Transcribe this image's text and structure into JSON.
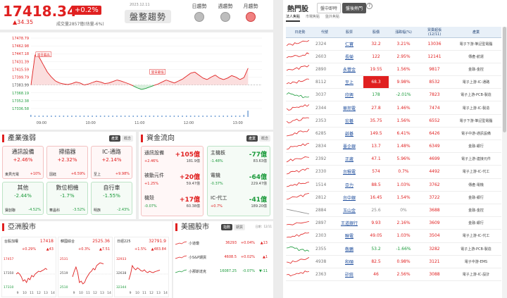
{
  "index": {
    "value": "17418.34",
    "change_pct": "+0.2%",
    "change_pts": "▲34.35",
    "volume": "成交量2857億(估量-6%)",
    "date": "2023.12.11",
    "trend": "盤整趨勢",
    "periods": [
      {
        "label": "日趨勢",
        "active": false
      },
      {
        "label": "週趨勢",
        "active": false
      },
      {
        "label": "月趨勢",
        "active": true
      }
    ]
  },
  "chart_data": {
    "type": "line",
    "y_ticks": [
      "17478.79",
      "17462.98",
      "17447.18",
      "17431.39",
      "17415.59",
      "17399.79",
      "17383.99",
      "17368.19",
      "17352.38",
      "17336.58"
    ],
    "x_ticks": [
      "09:00",
      "10:00",
      "11:00",
      "12:00",
      "13:00"
    ],
    "annotations": [
      "當日最高",
      "當日最低"
    ],
    "ylim": [
      17336.58,
      17478.79
    ],
    "series": [
      {
        "values": [
          17383.99,
          17445,
          17440,
          17425,
          17410,
          17400,
          17392,
          17388,
          17386,
          17385,
          17387,
          17390,
          17388,
          17384,
          17386,
          17389,
          17392,
          17390,
          17387,
          17388,
          17391,
          17394,
          17392,
          17389,
          17386,
          17382,
          17378,
          17375,
          17377,
          17380,
          17383,
          17386,
          17390,
          17394,
          17391,
          17388,
          17392,
          17396,
          17402,
          17408,
          17410,
          17404,
          17398,
          17395,
          17400,
          17404,
          17398,
          17395,
          17398,
          17403,
          17400,
          17395,
          17399,
          17418
        ]
      }
    ],
    "volume": [
      3,
      2,
      2,
      2,
      2,
      2,
      2,
      2,
      2,
      2,
      2,
      2,
      2,
      2,
      2,
      2,
      2,
      2,
      2,
      2,
      2,
      2,
      2,
      2,
      2,
      2,
      2,
      2,
      2,
      2,
      2,
      2,
      2,
      2,
      2,
      2,
      2,
      2,
      2,
      2,
      2,
      2,
      2,
      2,
      2,
      2,
      2,
      2,
      2,
      2,
      2,
      2,
      3,
      9
    ]
  },
  "industry": {
    "title": "產業強弱",
    "btns": [
      "產業",
      "概念"
    ],
    "cards": [
      {
        "name": "通訊設備",
        "pct": "+2.46%",
        "sub_name": "東貝光電",
        "sub_pct": "+10%",
        "up": true
      },
      {
        "name": "掃描器",
        "pct": "+2.32%",
        "sub_name": "因鈺",
        "sub_pct": "+6.59%",
        "up": true
      },
      {
        "name": "IC-通路",
        "pct": "+2.14%",
        "sub_name": "至上",
        "sub_pct": "+9.98%",
        "up": true
      },
      {
        "name": "其他",
        "pct": "-2.44%",
        "sub_name": "寶創聯",
        "sub_pct": "-4.52%",
        "up": false
      },
      {
        "name": "數位相機",
        "pct": "-1.7%",
        "sub_name": "華晶科",
        "sub_pct": "-3.52%",
        "up": false
      },
      {
        "name": "自行車",
        "pct": "-1.55%",
        "sub_name": "明族",
        "sub_pct": "-2.43%",
        "up": false
      }
    ]
  },
  "capital": {
    "title": "資金流向",
    "btns": [
      "產業",
      "概念"
    ],
    "items": [
      {
        "name": "通訊設備",
        "val": "+105億",
        "pct": "+2.46%",
        "vol": "181.9億",
        "up": true
      },
      {
        "name": "被動元件",
        "val": "+20億",
        "pct": "+1.25%",
        "vol": "59.47億",
        "up": true
      },
      {
        "name": "機殼",
        "val": "+17億",
        "pct": "-0.07%",
        "vol": "60.38億",
        "up": true
      },
      {
        "name": "主機板",
        "val": "-77億",
        "pct": "-1.48%",
        "vol": "83.63億",
        "up": false
      },
      {
        "name": "電機",
        "val": "-64億",
        "pct": "-0.37%",
        "vol": "229.47億",
        "up": false
      },
      {
        "name": "IC-代工",
        "val": "-41億",
        "pct": "+0.7%",
        "vol": "189.20億",
        "up": false
      }
    ]
  },
  "asia": {
    "title": "亞洲股市",
    "markets": [
      {
        "name": "台股加權",
        "value": "17418",
        "chg": "+0.29%",
        "pts": "▲43",
        "ticks": [
          "17457",
          "17350",
          "17310"
        ],
        "x": [
          "9",
          "10",
          "11",
          "12",
          "13",
          "14"
        ]
      },
      {
        "name": "韓國綜合",
        "value": "2525.36",
        "chg": "+0.3%",
        "pts": "▲7.51",
        "ticks": [
          "2531",
          "2519",
          "2510"
        ],
        "x": [
          "9",
          "10",
          "11",
          "12",
          "13",
          "14"
        ]
      },
      {
        "name": "日經225",
        "value": "32791.9",
        "chg": "+1.5%",
        "pts": "▲483.84",
        "ticks": [
          "32933",
          "32638",
          "32344"
        ],
        "x": [
          "9",
          "10",
          "11",
          "12",
          "13",
          "14"
        ]
      }
    ]
  },
  "us": {
    "title": "美國股市",
    "btns": [
      "指數",
      "期貨"
    ],
    "date": "日期：12/11",
    "rows": [
      {
        "name": "小道瓊",
        "value": "36293",
        "chg": "+0.04%",
        "pts": "▲13"
      },
      {
        "name": "小S&P期貨",
        "value": "4608.5",
        "chg": "+0.02%",
        "pts": "▲1"
      },
      {
        "name": "小那斯達克",
        "value": "16087.25",
        "chg": "-0.07%",
        "pts": "▼-11"
      }
    ]
  },
  "hot": {
    "title": "熱門股",
    "tabs": [
      "盤中即時",
      "盤後熱門"
    ],
    "help": "?",
    "subtabs": [
      "法人焦點",
      "市場焦點",
      "盤外焦點"
    ],
    "headers": [
      "日走勢",
      "代號",
      "股票",
      "股價",
      "漲跌幅(%)",
      "買賣超張\n(12/11)",
      "產業"
    ],
    "rows": [
      [
        "2324",
        "仁寶",
        "32.2",
        "3.21%",
        "13036",
        "電子下游-筆記型電腦"
      ],
      [
        "2603",
        "長榮",
        "122",
        "2.95%",
        "12141",
        "傳產-航運"
      ],
      [
        "2890",
        "永豐金",
        "19.55",
        "1.56%",
        "9817",
        "金融-金控"
      ],
      [
        "8112",
        "至上",
        "68.3",
        "9.98%",
        "8532",
        "電子上游-IC-通路"
      ],
      [
        "3037",
        "欣興",
        "178",
        "-2.01%",
        "7823",
        "電子上游-PCB-製造"
      ],
      [
        "2344",
        "華邦電",
        "27.8",
        "1.46%",
        "7474",
        "電子上游-IC-製造"
      ],
      [
        "2353",
        "宏碁",
        "35.75",
        "1.56%",
        "6552",
        "電子下游-筆記型電腦"
      ],
      [
        "6285",
        "啟碁",
        "149.5",
        "6.41%",
        "6426",
        "電子中游-通訊設備"
      ],
      [
        "2834",
        "臺企銀",
        "13.7",
        "1.48%",
        "6349",
        "金融-銀行"
      ],
      [
        "2392",
        "正崴",
        "47.1",
        "5.96%",
        "4699",
        "電子上游-連接元件"
      ],
      [
        "2330",
        "台積電",
        "574",
        "0.7%",
        "4492",
        "電子上游-IC-代工"
      ],
      [
        "1514",
        "亞力",
        "88.5",
        "1.03%",
        "3762",
        "傳產-電機"
      ],
      [
        "2812",
        "台中銀",
        "16.45",
        "1.54%",
        "3722",
        "金融-銀行"
      ],
      [
        "2884",
        "玉山金",
        "25.6",
        "0%",
        "3688",
        "金融-金控"
      ],
      [
        "2897",
        "王道銀行",
        "9.93",
        "2.16%",
        "3609",
        "金融-銀行"
      ],
      [
        "2303",
        "聯電",
        "49.05",
        "1.03%",
        "3504",
        "電子上游-IC-代工"
      ],
      [
        "2355",
        "敬鵬",
        "53.2",
        "-1.66%",
        "3282",
        "電子上游-PCB-製造"
      ],
      [
        "4938",
        "和碩",
        "82.5",
        "0.98%",
        "3121",
        "電子中游-EMS"
      ],
      [
        "2363",
        "矽統",
        "46",
        "2.56%",
        "3088",
        "電子上游-IC-設計"
      ]
    ]
  }
}
